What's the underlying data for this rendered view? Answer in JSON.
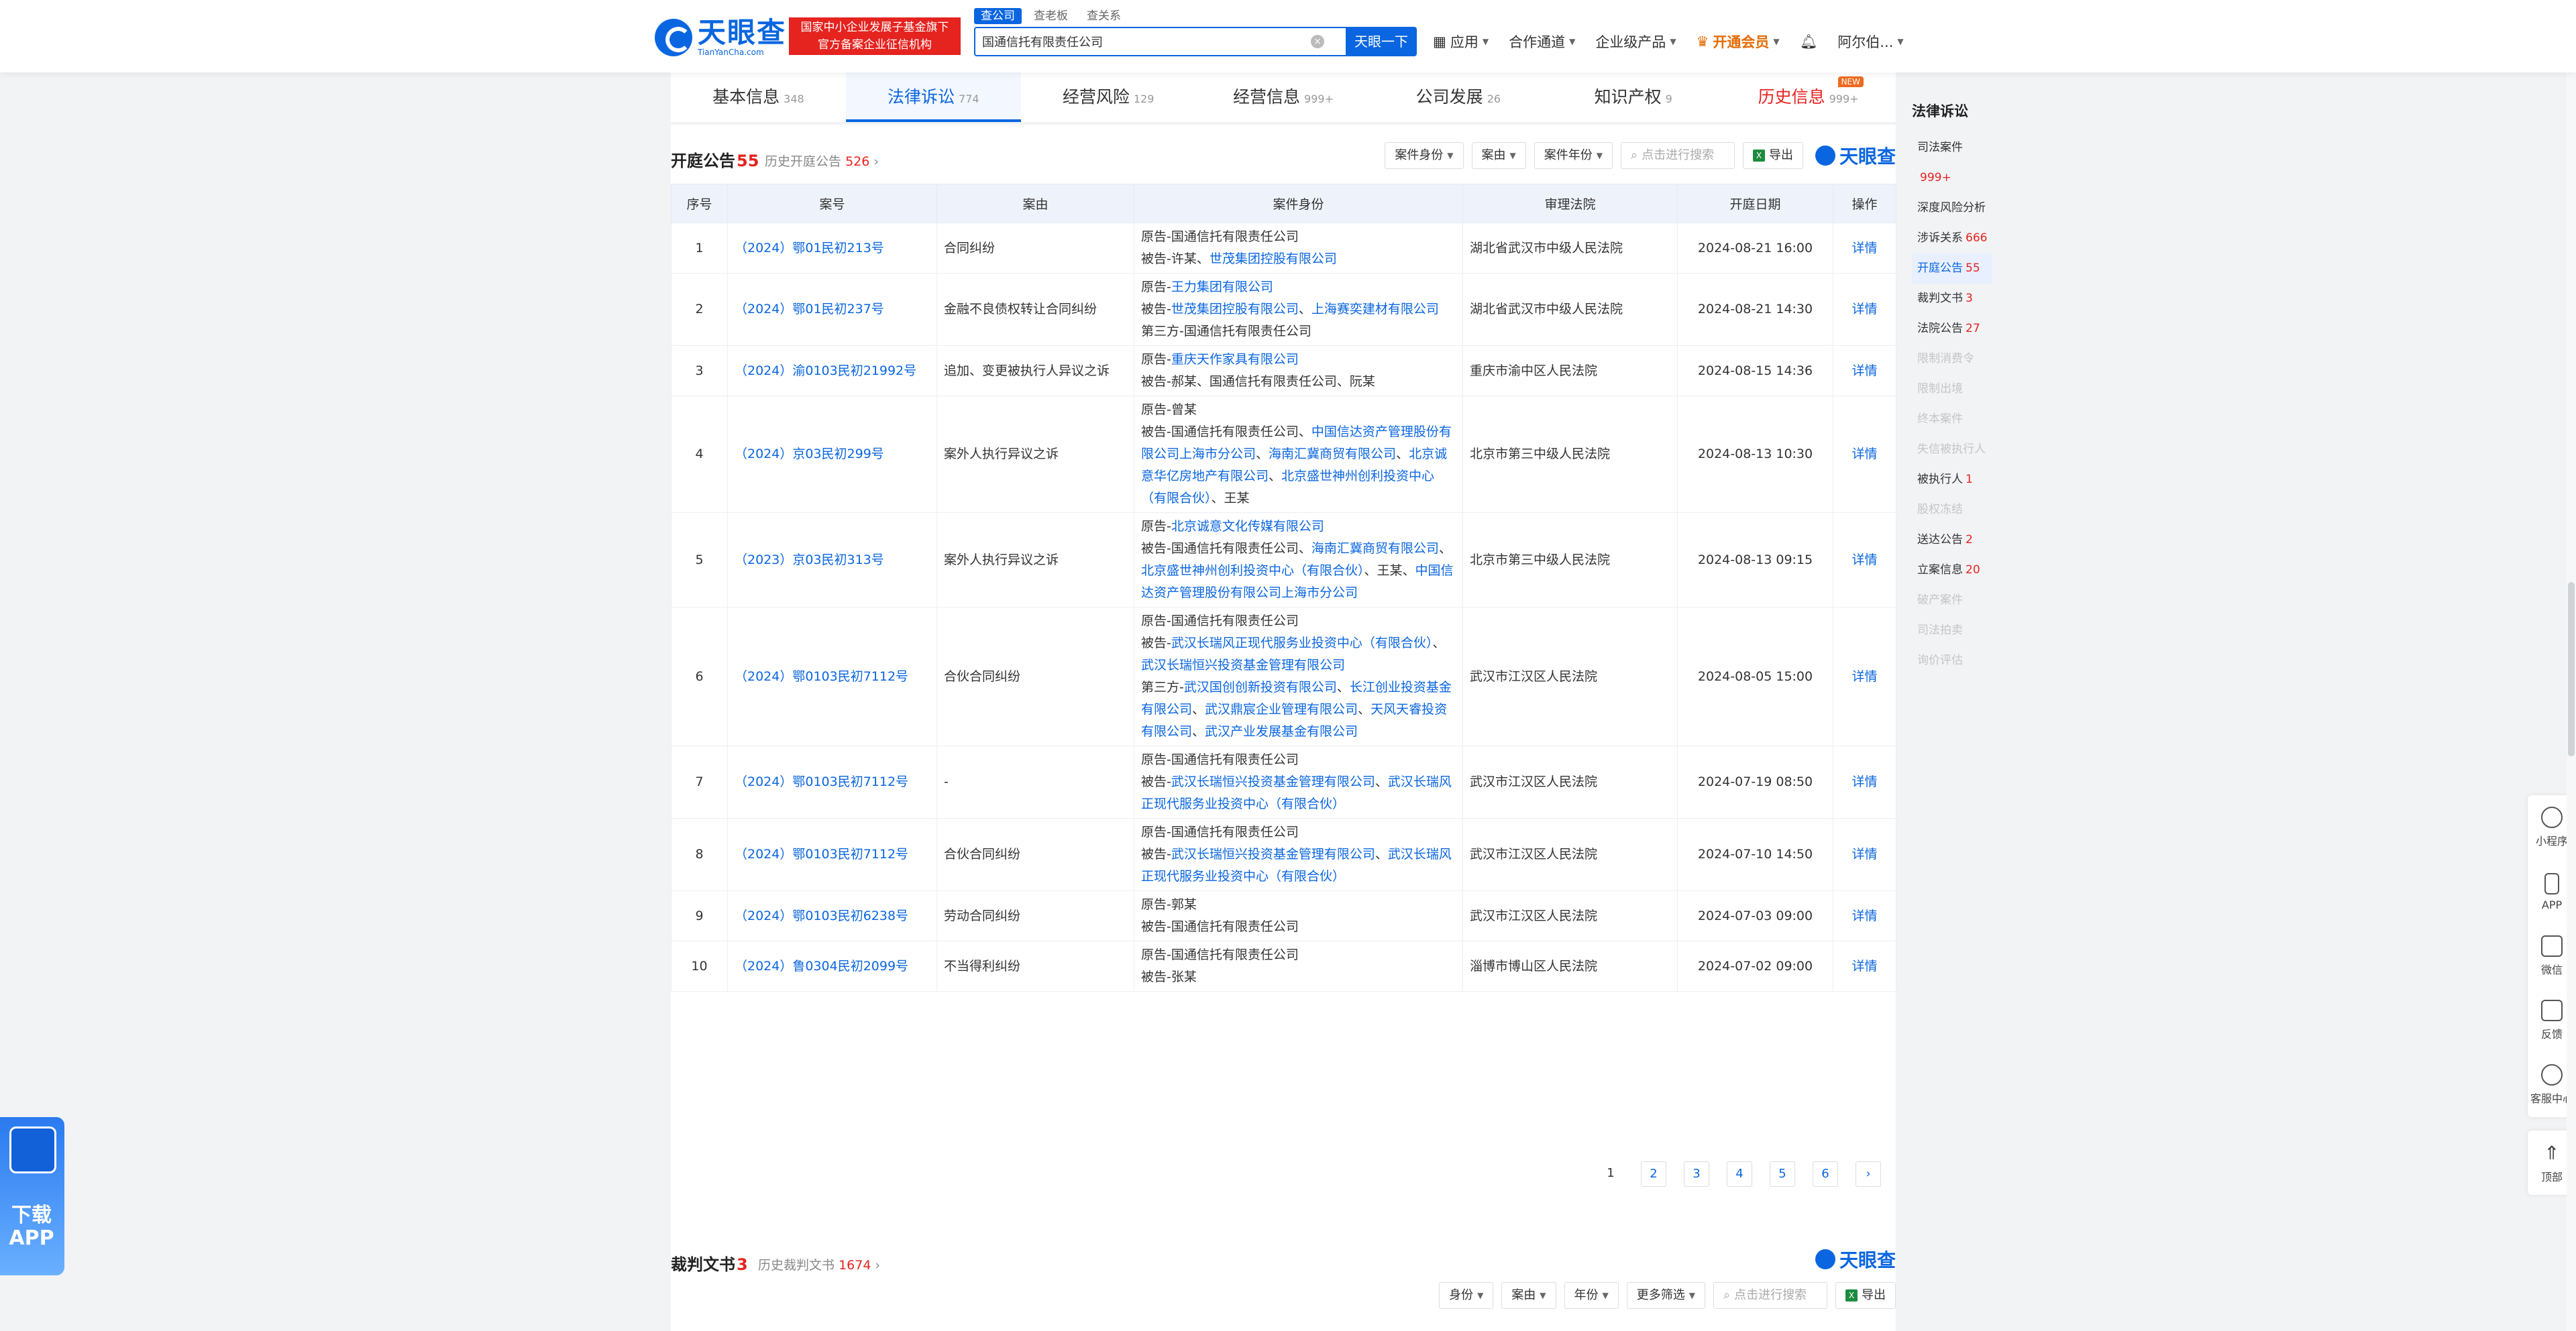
{
  "header": {
    "logo_cn": "天眼查",
    "logo_en": "TianYanCha.com",
    "badge_line1": "国家中小企业发展子基金旗下",
    "badge_line2": "官方备案企业征信机构",
    "search_tabs": [
      "查公司",
      "查老板",
      "查关系"
    ],
    "search_value": "国通信托有限责任公司",
    "search_button": "天眼一下",
    "nav": [
      "应用",
      "合作通道",
      "企业级产品",
      "开通会员",
      "阿尔伯..."
    ]
  },
  "tabs": [
    {
      "label": "基本信息",
      "count": "348"
    },
    {
      "label": "法律诉讼",
      "count": "774"
    },
    {
      "label": "经营风险",
      "count": "129"
    },
    {
      "label": "经营信息",
      "count": "999+"
    },
    {
      "label": "公司发展",
      "count": "26"
    },
    {
      "label": "知识产权",
      "count": "9"
    },
    {
      "label": "历史信息",
      "count": "999+",
      "badge": "NEW"
    }
  ],
  "section1": {
    "title": "开庭公告",
    "count": "55",
    "history_label": "历史开庭公告",
    "history_count": "526",
    "filters": [
      "案件身份",
      "案由",
      "案件年份"
    ],
    "search_placeholder": "点击进行搜索",
    "export": "导出",
    "brand": "天眼查",
    "columns": [
      "序号",
      "案号",
      "案由",
      "案件身份",
      "审理法院",
      "开庭日期",
      "操作"
    ],
    "rows": [
      {
        "idx": "1",
        "case": "（2024）鄂01民初213号",
        "cause": "合同纠纷",
        "lines": [
          [
            "原告-国通信托有限责任公司"
          ],
          [
            "被告-许某、",
            {
              "l": "世茂集团控股有限公司"
            }
          ]
        ],
        "court": "湖北省武汉市中级人民法院",
        "date": "2024-08-21 16:00",
        "op": "详情"
      },
      {
        "idx": "2",
        "case": "（2024）鄂01民初237号",
        "cause": "金融不良债权转让合同纠纷",
        "lines": [
          [
            "原告-",
            {
              "l": "王力集团有限公司"
            }
          ],
          [
            "被告-",
            {
              "l": "世茂集团控股有限公司"
            },
            "、",
            {
              "l": "上海赛奕建材有限公司"
            }
          ],
          [
            "第三方-国通信托有限责任公司"
          ]
        ],
        "court": "湖北省武汉市中级人民法院",
        "date": "2024-08-21 14:30",
        "op": "详情"
      },
      {
        "idx": "3",
        "case": "（2024）渝0103民初21992号",
        "cause": "追加、变更被执行人异议之诉",
        "lines": [
          [
            "原告-",
            {
              "l": "重庆天作家具有限公司"
            }
          ],
          [
            "被告-郝某、国通信托有限责任公司、阮某"
          ]
        ],
        "court": "重庆市渝中区人民法院",
        "date": "2024-08-15 14:36",
        "op": "详情"
      },
      {
        "idx": "4",
        "case": "（2024）京03民初299号",
        "cause": "案外人执行异议之诉",
        "lines": [
          [
            "原告-曾某"
          ],
          [
            "被告-国通信托有限责任公司、",
            {
              "l": "中国信达资产管理股份有限公司上海市分公司"
            },
            "、",
            {
              "l": "海南汇冀商贸有限公司"
            },
            "、",
            {
              "l": "北京诚意华亿房地产有限公司"
            },
            "、",
            {
              "l": "北京盛世神州创利投资中心（有限合伙）"
            },
            "、王某"
          ]
        ],
        "court": "北京市第三中级人民法院",
        "date": "2024-08-13 10:30",
        "op": "详情"
      },
      {
        "idx": "5",
        "case": "（2023）京03民初313号",
        "cause": "案外人执行异议之诉",
        "lines": [
          [
            "原告-",
            {
              "l": "北京诚意文化传媒有限公司"
            }
          ],
          [
            "被告-国通信托有限责任公司、",
            {
              "l": "海南汇冀商贸有限公司"
            },
            "、",
            {
              "l": "北京盛世神州创利投资中心（有限合伙）"
            },
            "、王某、",
            {
              "l": "中国信达资产管理股份有限公司上海市分公司"
            }
          ]
        ],
        "court": "北京市第三中级人民法院",
        "date": "2024-08-13 09:15",
        "op": "详情"
      },
      {
        "idx": "6",
        "case": "（2024）鄂0103民初7112号",
        "cause": "合伙合同纠纷",
        "lines": [
          [
            "原告-国通信托有限责任公司"
          ],
          [
            "被告-",
            {
              "l": "武汉长瑞风正现代服务业投资中心（有限合伙）"
            },
            "、",
            {
              "l": "武汉长瑞恒兴投资基金管理有限公司"
            }
          ],
          [
            "第三方-",
            {
              "l": "武汉国创创新投资有限公司"
            },
            "、",
            {
              "l": "长江创业投资基金有限公司"
            },
            "、",
            {
              "l": "武汉鼎宸企业管理有限公司"
            },
            "、",
            {
              "l": "天风天睿投资有限公司"
            },
            "、",
            {
              "l": "武汉产业发展基金有限公司"
            }
          ]
        ],
        "court": "武汉市江汉区人民法院",
        "date": "2024-08-05 15:00",
        "op": "详情"
      },
      {
        "idx": "7",
        "case": "（2024）鄂0103民初7112号",
        "cause": "-",
        "lines": [
          [
            "原告-国通信托有限责任公司"
          ],
          [
            "被告-",
            {
              "l": "武汉长瑞恒兴投资基金管理有限公司"
            },
            "、",
            {
              "l": "武汉长瑞风正现代服务业投资中心（有限合伙）"
            }
          ]
        ],
        "court": "武汉市江汉区人民法院",
        "date": "2024-07-19 08:50",
        "op": "详情"
      },
      {
        "idx": "8",
        "case": "（2024）鄂0103民初7112号",
        "cause": "合伙合同纠纷",
        "lines": [
          [
            "原告-国通信托有限责任公司"
          ],
          [
            "被告-",
            {
              "l": "武汉长瑞恒兴投资基金管理有限公司"
            },
            "、",
            {
              "l": "武汉长瑞风正现代服务业投资中心（有限合伙）"
            }
          ]
        ],
        "court": "武汉市江汉区人民法院",
        "date": "2024-07-10 14:50",
        "op": "详情"
      },
      {
        "idx": "9",
        "case": "（2024）鄂0103民初6238号",
        "cause": "劳动合同纠纷",
        "lines": [
          [
            "原告-郭某"
          ],
          [
            "被告-国通信托有限责任公司"
          ]
        ],
        "court": "武汉市江汉区人民法院",
        "date": "2024-07-03 09:00",
        "op": "详情"
      },
      {
        "idx": "10",
        "case": "（2024）鲁0304民初2099号",
        "cause": "不当得利纠纷",
        "lines": [
          [
            "原告-国通信托有限责任公司"
          ],
          [
            "被告-张某"
          ]
        ],
        "court": "淄博市博山区人民法院",
        "date": "2024-07-02 09:00",
        "op": "详情"
      }
    ],
    "pages": [
      "1",
      "2",
      "3",
      "4",
      "5",
      "6",
      "›"
    ]
  },
  "section2": {
    "title": "裁判文书",
    "count": "3",
    "history_label": "历史裁判文书",
    "history_count": "1674",
    "filters": [
      "身份",
      "案由",
      "年份",
      "更多筛选"
    ],
    "search_placeholder": "点击进行搜索",
    "export": "导出",
    "brand": "天眼查"
  },
  "sidebar": {
    "title": "法律诉讼",
    "items": [
      {
        "label": "司法案件",
        "count": "999+"
      },
      {
        "label": "深度风险分析",
        "count": ""
      },
      {
        "label": "涉诉关系",
        "count": "666"
      },
      {
        "label": "开庭公告",
        "count": "55",
        "active": true
      },
      {
        "label": "裁判文书",
        "count": "3"
      },
      {
        "label": "法院公告",
        "count": "27"
      },
      {
        "label": "限制消费令",
        "count": "",
        "disabled": true
      },
      {
        "label": "限制出境",
        "count": "",
        "disabled": true
      },
      {
        "label": "终本案件",
        "count": "",
        "disabled": true
      },
      {
        "label": "失信被执行人",
        "count": "",
        "disabled": true
      },
      {
        "label": "被执行人",
        "count": "1"
      },
      {
        "label": "股权冻结",
        "count": "",
        "disabled": true
      },
      {
        "label": "送达公告",
        "count": "2"
      },
      {
        "label": "立案信息",
        "count": "20"
      },
      {
        "label": "破产案件",
        "count": "",
        "disabled": true
      },
      {
        "label": "司法拍卖",
        "count": "",
        "disabled": true
      },
      {
        "label": "询价评估",
        "count": "",
        "disabled": true
      }
    ]
  },
  "float_bar": [
    "小程序",
    "APP",
    "微信",
    "反馈",
    "客服中心"
  ],
  "float_top": "顶部",
  "app_promo": {
    "line1": "下载",
    "line2": "APP"
  }
}
